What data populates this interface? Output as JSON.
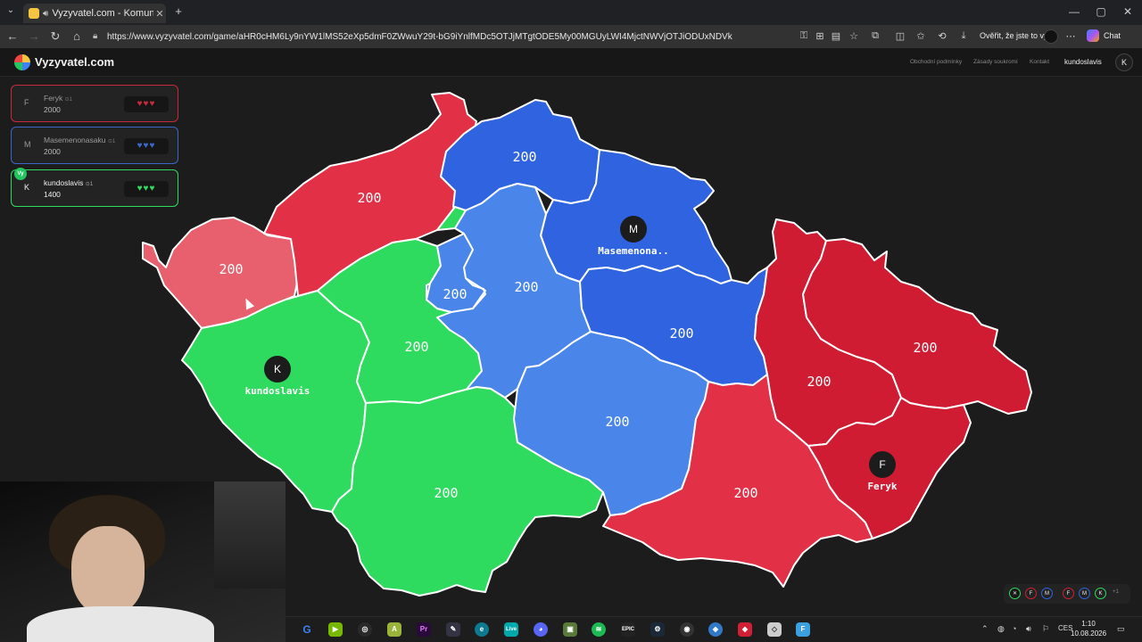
{
  "browser": {
    "tab_title": "Vyzyvatel.com - Komunitní vě",
    "url": "https://www.vyzyvatel.com/game/aHR0cHM6Ly9nYW1lMS52eXp5dmF0ZWwuY29t-bG9iYnlfMDc5OTJjMTgtODE5My00MGUyLWI4MjctNWVjOTJiODUxNDVk",
    "verify_text": "Ověřit, že jste to vy",
    "chat_label": "Chat"
  },
  "site": {
    "logo_text": "Vyzyvatel.com",
    "links": [
      "Obchodní podmínky",
      "Zásady soukromí",
      "Kontakt"
    ],
    "username": "kundoslavis",
    "user_initial": "K"
  },
  "players": [
    {
      "initial": "F",
      "name": "Feryk",
      "badge": "1",
      "score": "2000",
      "hearts": "♥♥♥",
      "color": "#d11f36"
    },
    {
      "initial": "M",
      "name": "Masemenonasaku",
      "badge": "1",
      "score": "2000",
      "hearts": "♥♥♥",
      "color": "#2f63e0"
    },
    {
      "initial": "K",
      "name": "kundoslavis",
      "badge": "1",
      "score": "1400",
      "hearts": "♥♥♥",
      "color": "#2fdb5e",
      "you": "Vy"
    }
  ],
  "map": {
    "colors": {
      "blue_dark": "#2f63e0",
      "blue_light": "#4a86ea",
      "green": "#2fdb5e",
      "red_dark": "#cf1c32",
      "red_mid": "#e23147",
      "red_light": "#e8606d"
    },
    "regions": [
      {
        "id": "karlovarsky",
        "owner": "red_light",
        "value": "200"
      },
      {
        "id": "ustecky",
        "owner": "red_mid",
        "value": "200"
      },
      {
        "id": "liberecky",
        "owner": "blue_dark",
        "value": "200"
      },
      {
        "id": "kralovehradecky",
        "owner": "blue_dark",
        "value": "200"
      },
      {
        "id": "plzensky",
        "owner": "green",
        "value": ""
      },
      {
        "id": "stredocesky",
        "owner": "green",
        "value": "200"
      },
      {
        "id": "praha",
        "owner": "blue_light",
        "value": "200"
      },
      {
        "id": "pardubicky",
        "owner": "blue_light",
        "value": "200"
      },
      {
        "id": "olomoucky_north",
        "owner": "blue_dark",
        "value": "200"
      },
      {
        "id": "jihocesky",
        "owner": "green",
        "value": "200"
      },
      {
        "id": "vysocina",
        "owner": "blue_light",
        "value": "200"
      },
      {
        "id": "jihomoravsky",
        "owner": "red_mid",
        "value": "200"
      },
      {
        "id": "olomoucky",
        "owner": "red_dark",
        "value": "200"
      },
      {
        "id": "moravskoslezsky",
        "owner": "red_dark",
        "value": "200"
      },
      {
        "id": "zlinsky",
        "owner": "red_dark",
        "value": ""
      }
    ],
    "markers": [
      {
        "initial": "K",
        "name": "kundoslavis"
      },
      {
        "initial": "M",
        "name": "Masemenona.."
      },
      {
        "initial": "F",
        "name": "Feryk"
      }
    ]
  },
  "mini_icons": [
    "F",
    "M",
    "F",
    "M",
    "K",
    "+1"
  ],
  "taskbar": {
    "time": "1:10",
    "date": "10.08.2026",
    "lang": "CES"
  }
}
